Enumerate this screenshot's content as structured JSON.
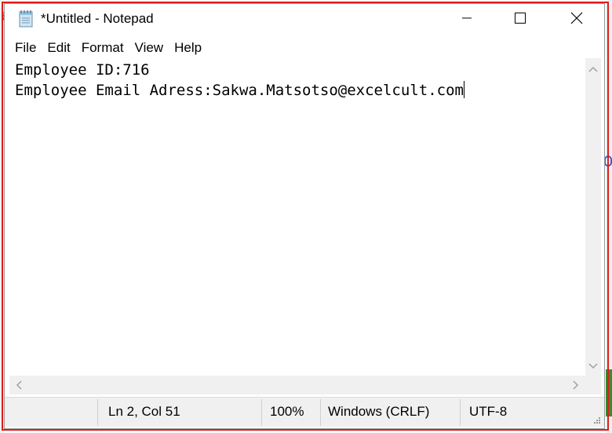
{
  "window": {
    "title": "*Untitled - Notepad",
    "icon": "notepad-icon",
    "controls": [
      "minimize-icon",
      "maximize-icon",
      "close-icon"
    ]
  },
  "menu": {
    "items": [
      {
        "label": "File"
      },
      {
        "label": "Edit"
      },
      {
        "label": "Format"
      },
      {
        "label": "View"
      },
      {
        "label": "Help"
      }
    ]
  },
  "editor": {
    "lines": [
      "Employee ID:716",
      "Employee Email Adress:Sakwa.Matsotso@excelcult.com"
    ]
  },
  "status": {
    "position": "Ln 2, Col 51",
    "zoom": "100%",
    "line_ending": "Windows (CRLF)",
    "encoding": "UTF-8"
  },
  "colors": {
    "highlight_frame": "#e01b1b",
    "statusbar_bg": "#f0f0f0"
  }
}
